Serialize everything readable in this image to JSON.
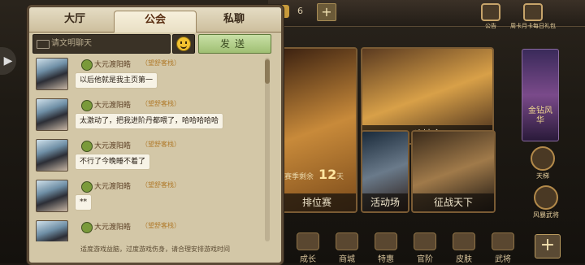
{
  "panel": {
    "tabs": [
      {
        "label": "大厅",
        "active": false
      },
      {
        "label": "公会",
        "active": true
      },
      {
        "label": "私聊",
        "active": false
      }
    ],
    "input_placeholder": "请文明聊天",
    "send_label": "发送",
    "messages": [
      {
        "sender": "大元渡阳皓",
        "guild": "（望舒客栈）",
        "text": "以后他就是我主页第一"
      },
      {
        "sender": "大元渡阳皓",
        "guild": "（望舒客栈）",
        "text": "太激动了，把我进阶丹都喂了，哈哈哈哈哈"
      },
      {
        "sender": "大元渡阳皓",
        "guild": "（望舒客栈）",
        "text": "不行了今晚睡不着了"
      },
      {
        "sender": "大元渡阳皓",
        "guild": "（望舒客栈）",
        "text": "**"
      },
      {
        "sender": "大元渡阳皓",
        "guild": "（望舒客栈）",
        "text": ""
      }
    ],
    "footer_note": "适度游戏益脑，过度游戏伤身，请合理安排游戏时间"
  },
  "topbar": {
    "currency_count": "6",
    "buttons": [
      {
        "label": "公告",
        "icon": "notice-icon"
      },
      {
        "label": "周卡月卡每日礼包",
        "icon": "gift-icon"
      }
    ]
  },
  "cards": [
    {
      "caption": "斗地主",
      "colors": [
        "#5a3a20",
        "#d8a048",
        "#3a2418"
      ]
    },
    {
      "caption": "排位赛",
      "badge_text": "赛季剩余",
      "badge_value": "12",
      "badge_unit": "天",
      "colors": [
        "#3a2010",
        "#c88a3a",
        "#7a4a1a"
      ]
    },
    {
      "caption": "活动场",
      "colors": [
        "#1a2a3a",
        "#6a7a8a",
        "#2a1a14"
      ]
    },
    {
      "caption": "征战天下",
      "colors": [
        "#3a2a1a",
        "#a07a4a",
        "#1a1410"
      ]
    }
  ],
  "side": [
    {
      "label": "天梯",
      "icon": "ladder-icon"
    },
    {
      "label": "风暴武将",
      "icon": "storm-general-icon"
    }
  ],
  "bottom_nav": [
    {
      "label": "成长",
      "icon": "growth-icon"
    },
    {
      "label": "商城",
      "icon": "shop-icon"
    },
    {
      "label": "特惠",
      "icon": "deal-icon"
    },
    {
      "label": "官阶",
      "icon": "rank-icon"
    },
    {
      "label": "皮肤",
      "icon": "skin-icon"
    },
    {
      "label": "武将",
      "icon": "general-icon"
    }
  ],
  "promo": {
    "text": "金钻风华"
  },
  "colors": {
    "accent": "#c7a46a",
    "send_green": "#9fbf73",
    "panel_bg": "#d3c7a7"
  }
}
